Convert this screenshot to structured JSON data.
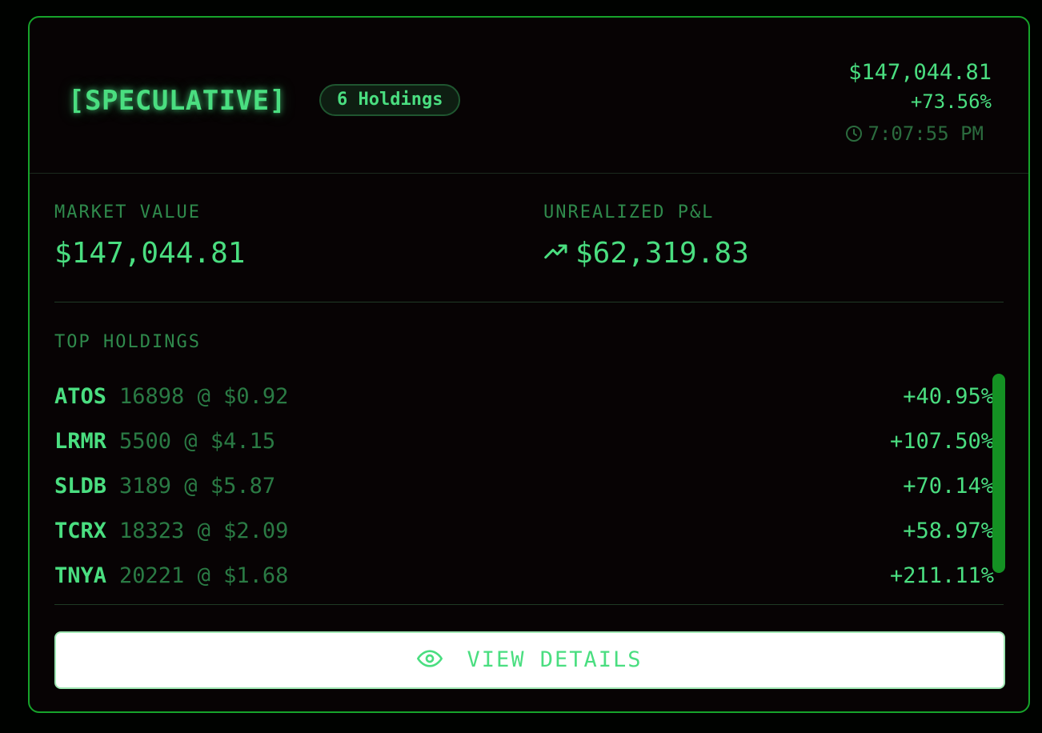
{
  "header": {
    "title": "[SPECULATIVE]",
    "holdings_badge": "6 Holdings",
    "total_value": "$147,044.81",
    "total_change": "+73.56%",
    "time": "7:07:55 PM",
    "time_icon": "clock-icon"
  },
  "metrics": {
    "market_value_label": "MARKET VALUE",
    "market_value": "$147,044.81",
    "pnl_label": "UNREALIZED P&L",
    "pnl_value": "$62,319.83",
    "pnl_icon": "trending-up-icon"
  },
  "top_holdings": {
    "label": "TOP HOLDINGS",
    "rows": [
      {
        "symbol": "ATOS",
        "detail": "16898 @ $0.92",
        "change": "+40.95%"
      },
      {
        "symbol": "LRMR",
        "detail": "5500 @ $4.15",
        "change": "+107.50%"
      },
      {
        "symbol": "SLDB",
        "detail": "3189 @ $5.87",
        "change": "+70.14%"
      },
      {
        "symbol": "TCRX",
        "detail": "18323 @ $2.09",
        "change": "+58.97%"
      },
      {
        "symbol": "TNYA",
        "detail": "20221 @ $1.68",
        "change": "+211.11%"
      }
    ]
  },
  "actions": {
    "view_details_label": "VIEW DETAILS",
    "view_details_icon": "eye-icon"
  },
  "colors": {
    "accent": "#4ade80",
    "border": "#16a32a",
    "muted": "#2f8a4c",
    "background": "#070304"
  }
}
